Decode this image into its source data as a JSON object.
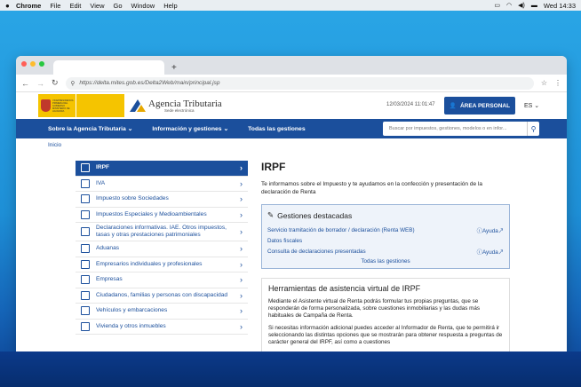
{
  "menubar": {
    "apple": "",
    "app": "Chrome",
    "items": [
      "File",
      "Edit",
      "View",
      "Go",
      "Window",
      "Help"
    ],
    "clock": "Wed 14:33"
  },
  "browser": {
    "new_tab": "+",
    "url": "https://delta.mites.gob.es/Delta2Web/main/principal.jsp"
  },
  "header": {
    "gov_text": "VICEPRESIDENCIA PRIMERA DEL GOBIERNO MINISTERIO DE HACIENDA",
    "agency_title": "Agencia Tributaria",
    "agency_sub": "Sede electrónica",
    "datetime": "12/03/2024 11:01:47",
    "area_button": "ÁREA PERSONAL",
    "lang": "ES"
  },
  "nav": {
    "items": [
      "Sobre la Agencia Tributaria",
      "Información y gestiones",
      "Todas las gestiones"
    ],
    "search_placeholder": "Buscar por impuestos, gestiones, modelos o en infor..."
  },
  "breadcrumb": "Inicio",
  "sidebar": [
    {
      "label": "IRPF",
      "icon": "irpf-icon",
      "active": true
    },
    {
      "label": "IVA",
      "icon": "iva-icon"
    },
    {
      "label": "Impuesto sobre Sociedades",
      "icon": "sociedades-icon"
    },
    {
      "label": "Impuestos Especiales y Medioambientales",
      "icon": "especiales-icon"
    },
    {
      "label": "Declaraciones informativas. IAE. Otros impuestos, tasas y otras prestaciones patrimoniales",
      "icon": "declaraciones-icon"
    },
    {
      "label": "Aduanas",
      "icon": "aduanas-icon"
    },
    {
      "label": "Empresarios individuales y profesionales",
      "icon": "empresarios-icon"
    },
    {
      "label": "Empresas",
      "icon": "empresas-icon"
    },
    {
      "label": "Ciudadanos, familias y personas con discapacidad",
      "icon": "ciudadanos-icon"
    },
    {
      "label": "Vehículos y embarcaciones",
      "icon": "vehiculos-icon"
    },
    {
      "label": "Vivienda y otros inmuebles",
      "icon": "vivienda-icon"
    }
  ],
  "main": {
    "title": "IRPF",
    "intro": "Te informamos sobre el Impuesto y te ayudamos en la confección y presentación de la declaración de Renta",
    "gestiones_title": "Gestiones destacadas",
    "gestiones": [
      {
        "label": "Servicio tramitación de borrador / declaración (Renta WEB)",
        "ayuda": "Ayuda"
      },
      {
        "label": "Datos fiscales",
        "ayuda": ""
      },
      {
        "label": "Consulta de declaraciones presentadas",
        "ayuda": "Ayuda"
      }
    ],
    "gestiones_all": "Todas las gestiones",
    "asist_title": "Herramientas de asistencia virtual de IRPF",
    "asist_p1": "Mediante el Asistente virtual de Renta podrás formular tus propias preguntas, que se responderán de forma personalizada, sobre cuestiones inmobiliarias y las dudas más habituales de Campaña de Renta.",
    "asist_p2": "Si necesitas información adicional puedes acceder al Informador de Renta, que te permitirá ir seleccionando las distintas opciones que se mostrarán para obtener respuesta a preguntas de carácter general del IRPF, así como a cuestiones"
  }
}
